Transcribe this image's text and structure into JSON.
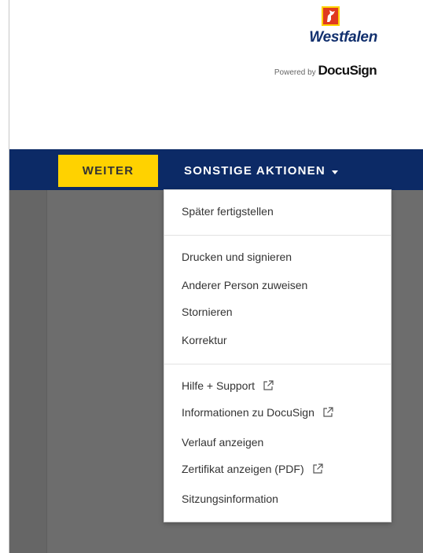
{
  "header": {
    "logo_text": "Westfalen",
    "powered_prefix": "Powered by",
    "powered_brand": "DocuSign"
  },
  "toolbar": {
    "continue_label": "WEITER",
    "more_actions_label": "SONSTIGE AKTIONEN"
  },
  "menu": {
    "finish_later": "Später fertigstellen",
    "print_and_sign": "Drucken und signieren",
    "assign_other": "Anderer Person zuweisen",
    "cancel": "Stornieren",
    "correct": "Korrektur",
    "help_support": "Hilfe + Support",
    "about_docusign": "Informationen zu DocuSign",
    "view_history": "Verlauf anzeigen",
    "view_certificate": "Zertifikat anzeigen (PDF)",
    "session_info": "Sitzungsinformation"
  },
  "colors": {
    "toolbar_bg": "#0c2a66",
    "continue_button": "#ffd200",
    "logo_blue": "#12306e",
    "logo_red": "#e03a1e"
  }
}
